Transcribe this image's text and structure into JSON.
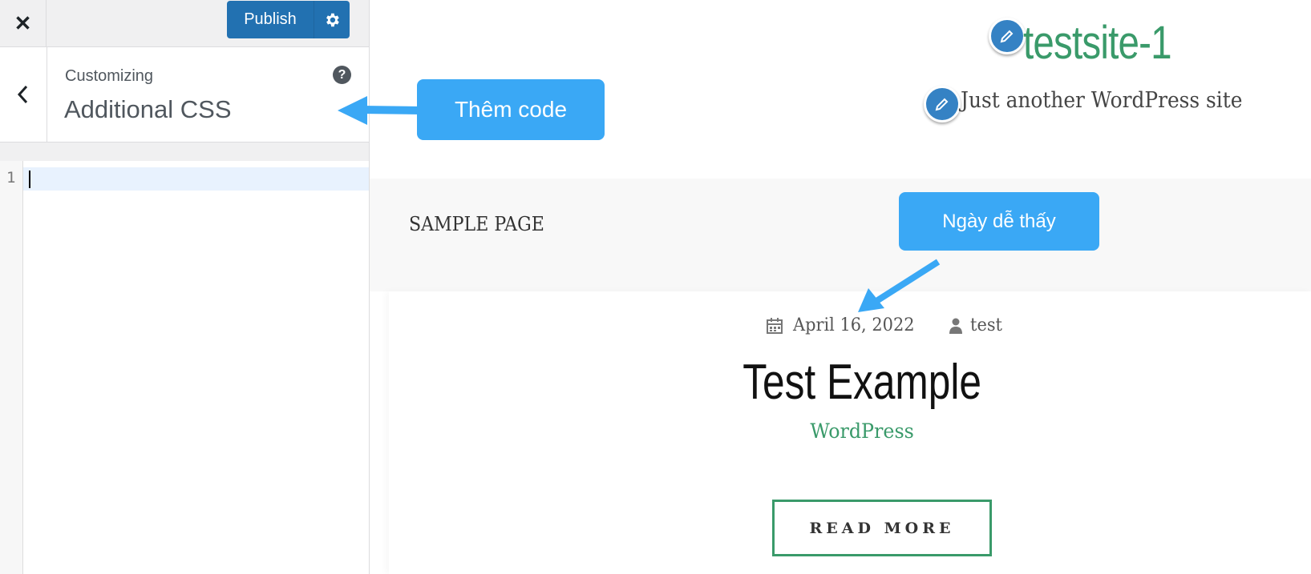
{
  "sidebar": {
    "close_icon": "close-icon",
    "publish_label": "Publish",
    "publish_settings_icon": "gear-icon",
    "back_icon": "chevron-left-icon",
    "customizing_label": "Customizing",
    "section_title": "Additional CSS",
    "help_icon": "help-icon",
    "help_glyph": "?",
    "editor": {
      "line_numbers": [
        "1"
      ],
      "content": ""
    }
  },
  "preview": {
    "site_title": "testsite-1",
    "tagline": "Just another WordPress site",
    "nav": {
      "items": [
        "SAMPLE PAGE"
      ]
    },
    "post": {
      "date": "April 16, 2022",
      "author": "test",
      "title": "Test Example",
      "category": "WordPress",
      "read_more": "READ MORE"
    }
  },
  "annotations": {
    "callout_add_code": "Thêm code",
    "callout_easy_date": "Ngày dễ thấy"
  },
  "colors": {
    "publish_bg": "#2271b1",
    "accent_green": "#3a9a6a",
    "callout_blue": "#3aa8f5",
    "edit_pencil_blue": "#3582c4"
  }
}
